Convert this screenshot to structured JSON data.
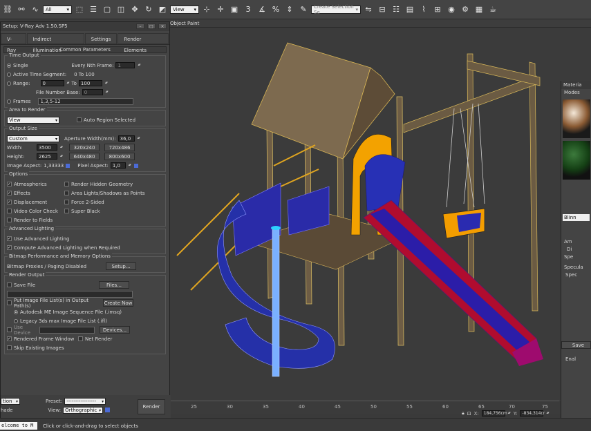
{
  "toolbar": {
    "filter_value": "All",
    "view_value": "View",
    "snap_label": "3",
    "selection_set_placeholder": "Create Selection Se"
  },
  "viewport": {
    "menu_label": "Object Paint",
    "ruler_ticks": [
      "25",
      "30",
      "35",
      "40",
      "45",
      "50",
      "55",
      "60",
      "65",
      "70",
      "75"
    ],
    "coord_x": "184,756cm",
    "coord_y": "-834,314cr"
  },
  "render_setup": {
    "title": "Setup: V-Ray Adv 1.50.SP5",
    "tabs": [
      "V-Ray",
      "Indirect illumination",
      "Settings",
      "Render Elements"
    ],
    "common_params": "Common Parameters",
    "time_output": {
      "title": "Time Output",
      "single": "Single",
      "every_nth_label": "Every Nth Frame:",
      "every_nth_value": "1",
      "active_segment": "Active Time Segment:",
      "active_range": "0 To 100",
      "range": "Range:",
      "range_from": "0",
      "range_to_label": "To",
      "range_to": "100",
      "file_number_base": "File Number Base:",
      "file_number_value": "0",
      "frames": "Frames",
      "frames_value": "1,3,5-12"
    },
    "area_to_render": {
      "title": "Area to Render",
      "value": "View",
      "auto_region": "Auto Region Selected"
    },
    "output_size": {
      "title": "Output Size",
      "preset": "Custom",
      "aperture_label": "Aperture Width(mm):",
      "aperture_value": "36,0",
      "width_label": "Width:",
      "width_value": "3500",
      "height_label": "Height:",
      "height_value": "2625",
      "presets": [
        "320x240",
        "720x486",
        "640x480",
        "800x600"
      ],
      "image_aspect_label": "Image Aspect:",
      "image_aspect_value": "1,33333",
      "pixel_aspect_label": "Pixel Aspect:",
      "pixel_aspect_value": "1,0"
    },
    "options": {
      "title": "Options",
      "items": [
        "Atmospherics",
        "Render Hidden Geometry",
        "Effects",
        "Area Lights/Shadows as Points",
        "Displacement",
        "Force 2-Sided",
        "Video Color Check",
        "Super Black",
        "Render to Fields"
      ]
    },
    "advanced_lighting": {
      "title": "Advanced Lighting",
      "use": "Use Advanced Lighting",
      "compute": "Compute Advanced Lighting when Required"
    },
    "bitmap": {
      "title": "Bitmap Performance and Memory Options",
      "status": "Bitmap Proxies / Paging Disabled",
      "setup_btn": "Setup..."
    },
    "render_output": {
      "title": "Render Output",
      "save_file": "Save File",
      "files_btn": "Files...",
      "put_list": "Put Image File List(s) in Output Path(s)",
      "create_now": "Create Now",
      "autodesk": "Autodesk ME Image Sequence File (.imsq)",
      "legacy": "Legacy 3ds max Image File List (.ifl)",
      "use_device": "Use Device",
      "devices_btn": "Devices...",
      "rendered_window": "Rendered Frame Window",
      "net_render": "Net Render",
      "skip_existing": "Skip Existing Images"
    },
    "bottom": {
      "mode_value": "tion",
      "shade_label": "hade",
      "preset_label": "Preset:",
      "preset_value": "-----------------",
      "view_label": "View:",
      "view_value": "Orthographic",
      "render_btn": "Render"
    }
  },
  "material_editor": {
    "title": "Materia",
    "menu": "Modes",
    "shader": "Blinn",
    "labels": [
      "Am",
      "Di",
      "Spe",
      "Specula",
      "Spec",
      "Save",
      "Enal"
    ]
  },
  "status": {
    "listener": "elcome to M",
    "prompt": "Click or click-and-drag to select objects"
  }
}
